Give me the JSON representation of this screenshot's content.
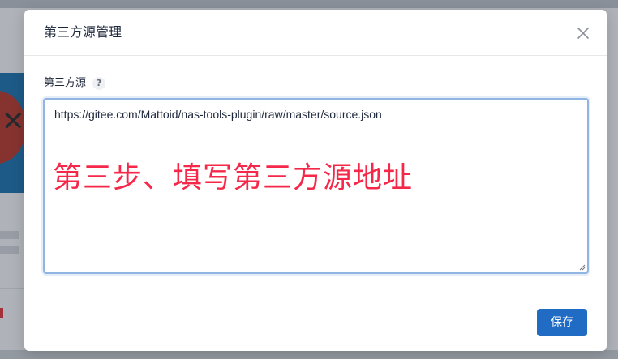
{
  "modal": {
    "title": "第三方源管理",
    "close_icon": "close-icon",
    "field_label": "第三方源",
    "help_badge": "?",
    "textarea_value": "https://gitee.com/Mattoid/nas-tools-plugin/raw/master/source.json",
    "annotation": "第三步、填写第三方源地址",
    "save_label": "保存"
  },
  "colors": {
    "accent": "#206bc4",
    "annotation": "#f5284a",
    "focus_border": "#90b5e2"
  }
}
